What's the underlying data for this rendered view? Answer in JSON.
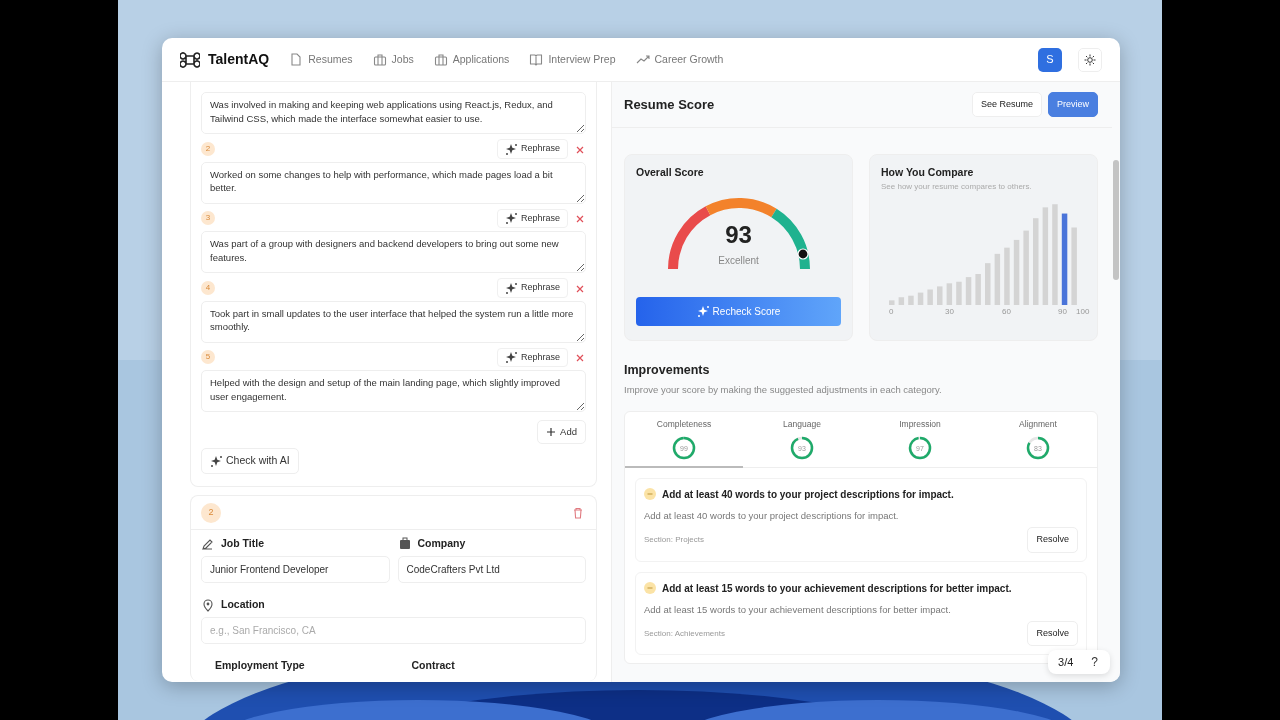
{
  "app": {
    "logo": "TalentAQ",
    "avatar": "S",
    "nav": [
      {
        "label": "Resumes"
      },
      {
        "label": "Jobs"
      },
      {
        "label": "Applications"
      },
      {
        "label": "Interview Prep"
      },
      {
        "label": "Career Growth"
      }
    ]
  },
  "bullets": [
    {
      "text": "Was involved in making and keeping web applications using React.js, Redux, and Tailwind CSS, which made the interface somewhat easier to use."
    },
    {
      "number": "2",
      "action": "Rephrase",
      "text": "Worked on some changes to help with performance, which made pages load a bit better."
    },
    {
      "number": "3",
      "action": "Rephrase",
      "text": "Was part of a group with designers and backend developers to bring out some new features."
    },
    {
      "number": "4",
      "action": "Rephrase",
      "text": "Took part in small updates to the user interface that helped the system run a little more smoothly."
    },
    {
      "number": "5",
      "action": "Rephrase",
      "text": "Helped with the design and setup of the main landing page, which slightly improved user engagement."
    }
  ],
  "add_button": "Add",
  "check_button": "Check with AI",
  "experience": {
    "number": "2",
    "fields": [
      {
        "label": "Job Title",
        "value": "Junior Frontend Developer"
      },
      {
        "label": "Company",
        "value": "CodeCrafters Pvt Ltd"
      },
      {
        "label": "Location",
        "placeholder": "e.g., San Francisco, CA"
      }
    ],
    "more_labels": [
      "Employment Type",
      "Contract"
    ]
  },
  "score_panel": {
    "title": "Resume Score",
    "buttons": [
      {
        "label": "See Resume",
        "kind": "outline"
      },
      {
        "label": "Preview",
        "kind": "primary"
      }
    ]
  },
  "overall": {
    "title": "Overall Score",
    "score": "93",
    "rating": "Excellent",
    "button": "Recheck Score"
  },
  "compare": {
    "title": "How You Compare",
    "subtitle": "See how your resume compares to others.",
    "axis_labels": [
      "0",
      "30",
      "60",
      "90",
      "100"
    ]
  },
  "improvements": {
    "title": "Improvements",
    "subtitle": "Improve your score by making the suggested adjustments in each category.",
    "tabs": [
      {
        "label": "Completeness",
        "score": "99",
        "selected": true
      },
      {
        "label": "Language",
        "score": "93",
        "selected": false
      },
      {
        "label": "Impression",
        "score": "97",
        "selected": false
      },
      {
        "label": "Alignment",
        "score": "83",
        "selected": false
      }
    ],
    "suggestions": [
      {
        "title": "Add at least 40 words to your project descriptions for impact.",
        "detail": "Add at least 40 words to your project descriptions for impact.",
        "section": "Section: Projects",
        "button": "Resolve"
      },
      {
        "title": "Add at least 15 words to your achievement descriptions for better impact.",
        "detail": "Add at least 15 words to your achievement descriptions for better impact.",
        "section": "Section: Achievements",
        "button": "Resolve"
      }
    ]
  },
  "pager": {
    "text": "3/4",
    "help": "?"
  }
}
